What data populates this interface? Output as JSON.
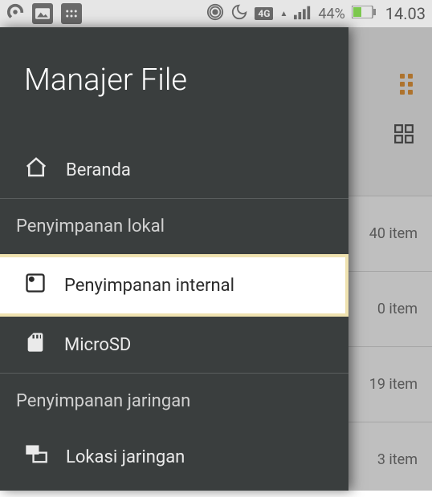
{
  "status_bar": {
    "signal_type": "4G",
    "battery_pct": "44%",
    "time": "14.03",
    "triangle_label": "▲"
  },
  "behind": {
    "rows": [
      {
        "count": "40 item"
      },
      {
        "count": "0 item"
      },
      {
        "count": "19 item"
      },
      {
        "count": "3 item"
      }
    ]
  },
  "drawer": {
    "title": "Manajer File",
    "home_label": "Beranda",
    "section_local": "Penyimpanan lokal",
    "item_internal": "Penyimpanan internal",
    "item_sd": "MicroSD",
    "section_network": "Penyimpanan jaringan",
    "item_network_location": "Lokasi jaringan"
  }
}
